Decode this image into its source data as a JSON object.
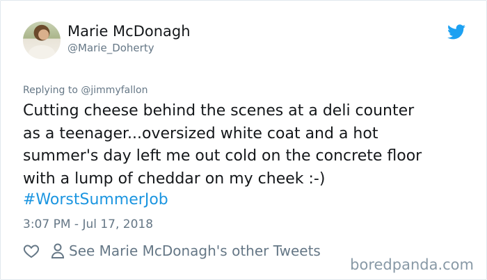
{
  "author": {
    "display_name": "Marie McDonagh",
    "handle": "@Marie_Doherty"
  },
  "reply": {
    "prefix": "Replying to ",
    "to_handle": "@jimmyfallon"
  },
  "tweet": {
    "text": "Cutting cheese behind the scenes at a deli counter\nas a teenager...oversized white coat and a hot\nsummer's day left me out cold on the concrete floor\nwith a lump of cheddar on my cheek :-)",
    "hashtag": "#WorstSummerJob",
    "timestamp": "3:07 PM - Jul 17, 2018"
  },
  "actions": {
    "like_icon": "heart-icon",
    "profile_icon": "person-icon",
    "other_tweets_label": "See Marie McDonagh's other Tweets"
  },
  "icons": {
    "platform": "twitter-bird-icon"
  },
  "watermark": "boredpanda.com",
  "colors": {
    "link": "#1b95e0",
    "secondary_text": "#657786",
    "primary_text": "#14171a",
    "twitter_blue": "#1da1f2"
  }
}
